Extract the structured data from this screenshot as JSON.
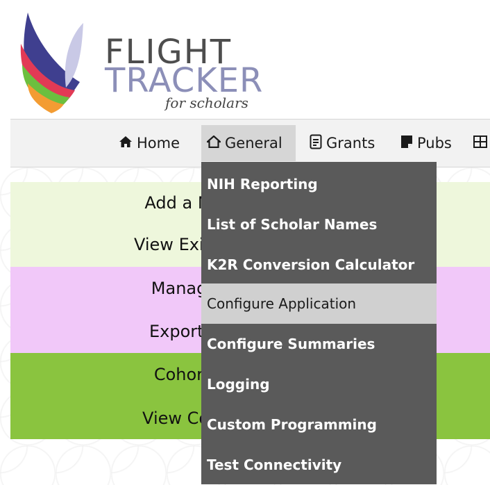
{
  "logo": {
    "line1": "FLIGHT",
    "line2": "TRACKER",
    "line3": "for scholars"
  },
  "nav": {
    "home": "Home",
    "general": "General",
    "grants": "Grants",
    "pubs": "Pubs",
    "icons": {
      "home": "home-icon",
      "general": "home-outline-icon",
      "grants": "document-icon",
      "pubs": "book-icon",
      "more": "grid-icon"
    }
  },
  "bands": {
    "add_new": "Add a New C",
    "view_existing": "View Existing C",
    "manage": "Manage Co",
    "export": "Export a Co",
    "cohort_pro": "Cohort Pro",
    "view_cohort": "View Cohort I"
  },
  "dropdown": {
    "items": [
      "NIH Reporting",
      "List of Scholar Names",
      "K2R Conversion Calculator",
      "Configure Application",
      "Configure Summaries",
      "Logging",
      "Custom Programming",
      "Test Connectivity"
    ],
    "active_index": 3
  },
  "colors": {
    "band_light_green": "#eef7dc",
    "band_pink": "#f1c8f9",
    "band_green": "#8ac43f",
    "dropdown_bg": "#5a5a5a",
    "dropdown_active": "#d0d0d0"
  }
}
